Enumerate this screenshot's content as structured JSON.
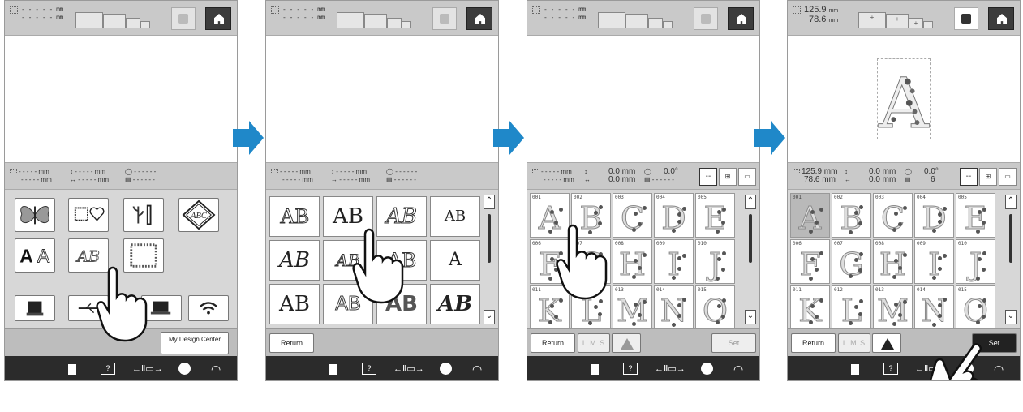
{
  "colors": {
    "accent_arrow": "#1f88c9",
    "panel_bg": "#c9c9c9",
    "statusbar_bg": "#2b2b2b",
    "set_active_bg": "#222222"
  },
  "common": {
    "size_blank_w": "- - - - - mm",
    "size_blank_h": "- - - - - mm",
    "info_blank": "- - - - - mm",
    "info_dash": "- - - - - -",
    "status_help": "?",
    "status_thread": "←Ⅱ▭→",
    "status_wifi": "◠"
  },
  "screens": [
    {
      "categories": [
        {
          "name": "butterfly-category",
          "icon": "butterfly-icon"
        },
        {
          "name": "frame-heart-category",
          "icon": "frame-heart-icon"
        },
        {
          "name": "border-category",
          "icon": "border-icon"
        },
        {
          "name": "monogram-category",
          "icon": "monogram-icon",
          "text": "ABC"
        },
        {
          "name": "alphabet-category",
          "text": "AA"
        },
        {
          "name": "decorative-alphabet-category",
          "text": "AB"
        },
        {
          "name": "frame-pattern-category",
          "icon": "frame-pattern-icon"
        }
      ],
      "icons": [
        "embroidery-machine-icon",
        "usb-icon",
        "pc-icon",
        "wireless-icon"
      ],
      "mdc_label": "My Design Center"
    },
    {
      "fonts": [
        "AB",
        "AB",
        "AB",
        "AB",
        "AB",
        "AB",
        "AB",
        "A",
        "AB",
        "AB",
        "AB",
        "AB"
      ],
      "return_label": "Return"
    },
    {
      "info": {
        "h": "0.0 mm",
        "v": "0.0 mm",
        "angle": "0.0°"
      },
      "view_labels": [
        "☷",
        "⊞",
        "▭"
      ],
      "letters": [
        {
          "num": "001",
          "ch": "A"
        },
        {
          "num": "002",
          "ch": "B"
        },
        {
          "num": "003",
          "ch": "C"
        },
        {
          "num": "004",
          "ch": "D"
        },
        {
          "num": "005",
          "ch": "E"
        },
        {
          "num": "006",
          "ch": "F"
        },
        {
          "num": "007",
          "ch": "G"
        },
        {
          "num": "008",
          "ch": "H"
        },
        {
          "num": "009",
          "ch": "I"
        },
        {
          "num": "010",
          "ch": "J"
        },
        {
          "num": "011",
          "ch": "K"
        },
        {
          "num": "012",
          "ch": "L"
        },
        {
          "num": "013",
          "ch": "M"
        },
        {
          "num": "014",
          "ch": "N"
        },
        {
          "num": "015",
          "ch": "O"
        }
      ],
      "return_label": "Return",
      "lms_label": "L M S",
      "set_label": "Set"
    },
    {
      "size": {
        "w": "125.9",
        "h": "78.6",
        "unit": "mm"
      },
      "info": {
        "w": "125.9 mm",
        "h": "78.6 mm",
        "x": "0.0 mm",
        "y": "0.0 mm",
        "angle": "0.0°",
        "colors": "6"
      },
      "view_labels": [
        "☷",
        "⊞",
        "▭"
      ],
      "preview_letter": "A",
      "hoop_plus": "+",
      "letters": [
        {
          "num": "001",
          "ch": "A"
        },
        {
          "num": "002",
          "ch": "B"
        },
        {
          "num": "003",
          "ch": "C"
        },
        {
          "num": "004",
          "ch": "D"
        },
        {
          "num": "005",
          "ch": "E"
        },
        {
          "num": "006",
          "ch": "F"
        },
        {
          "num": "007",
          "ch": "G"
        },
        {
          "num": "008",
          "ch": "H"
        },
        {
          "num": "009",
          "ch": "I"
        },
        {
          "num": "010",
          "ch": "J"
        },
        {
          "num": "011",
          "ch": "K"
        },
        {
          "num": "012",
          "ch": "L"
        },
        {
          "num": "013",
          "ch": "M"
        },
        {
          "num": "014",
          "ch": "N"
        },
        {
          "num": "015",
          "ch": "O"
        }
      ],
      "return_label": "Return",
      "lms_label": "L M S",
      "set_label": "Set"
    }
  ]
}
